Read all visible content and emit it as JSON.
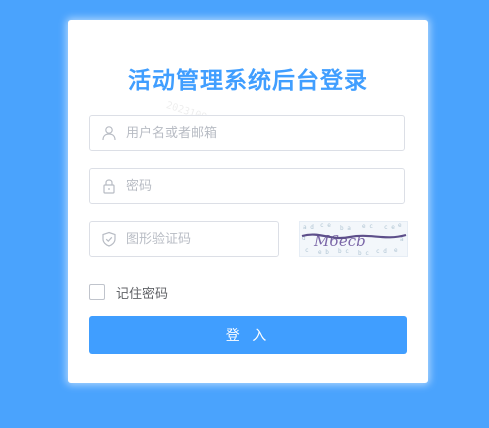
{
  "login": {
    "title": "活动管理系统后台登录",
    "watermark": "2023109-01",
    "username_placeholder": "用户名或者邮箱",
    "password_placeholder": "密码",
    "captcha_placeholder": "图形验证码",
    "captcha_text": "M6ecb",
    "remember_label": "记住密码",
    "remember_checked": false,
    "submit_label": "登 入"
  },
  "colors": {
    "background": "#4aa3fd",
    "accent": "#409eff",
    "card": "#ffffff"
  },
  "icons": {
    "username": "user-icon",
    "password": "lock-icon",
    "captcha": "shield-check-icon"
  }
}
